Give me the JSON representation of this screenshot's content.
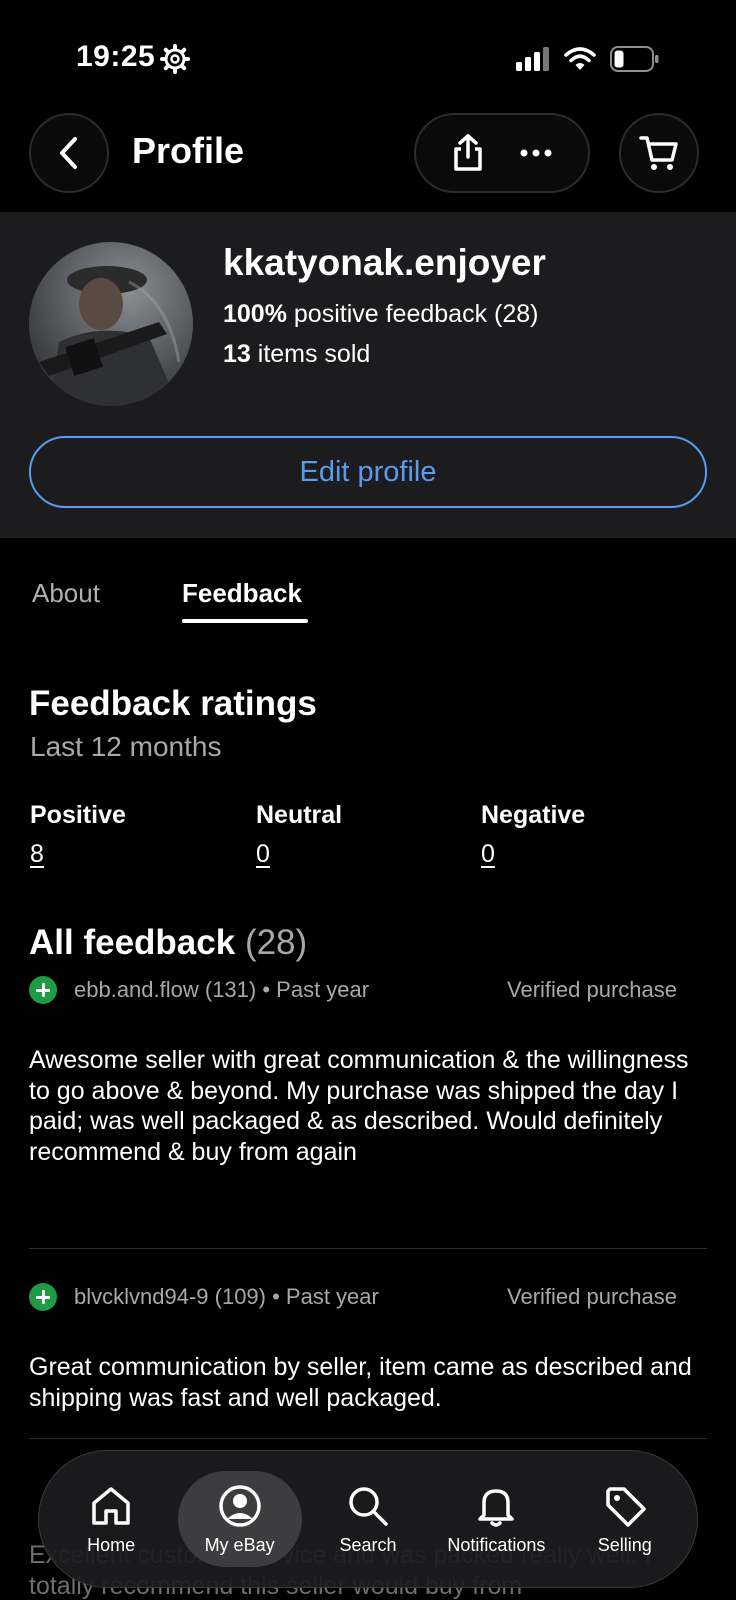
{
  "status_bar": {
    "time": "19:25"
  },
  "header": {
    "title": "Profile"
  },
  "profile": {
    "username": "kkatyonak.enjoyer",
    "feedback_percent": "100%",
    "feedback_text": " positive feedback (28)",
    "items_sold_count": "13",
    "items_sold_text": " items sold",
    "edit_button": "Edit profile"
  },
  "tabs": [
    {
      "label": "About",
      "active": false
    },
    {
      "label": "Feedback",
      "active": true
    }
  ],
  "ratings": {
    "title": "Feedback ratings",
    "subtitle": "Last 12 months",
    "positive": {
      "label": "Positive",
      "value": "8"
    },
    "neutral": {
      "label": "Neutral",
      "value": "0"
    },
    "negative": {
      "label": "Negative",
      "value": "0"
    }
  },
  "all_feedback": {
    "title": "All feedback",
    "count": "(28)",
    "items": [
      {
        "user": "ebb.and.flow (131) • Past year",
        "verified": "Verified purchase",
        "text": "Awesome seller with great communication & the willingness to go above & beyond. My purchase was shipped the day I paid; was well packaged & as described. Would definitely recommend & buy from again"
      },
      {
        "user": "blvcklvnd94-9 (109) • Past year",
        "verified": "Verified purchase",
        "text": "Great communication by seller, item came as described and shipping was fast and well packaged."
      }
    ],
    "partial_text": "Excellent customer service and was packed really well. I totally recommend this seller would buy from"
  },
  "bottom_nav": [
    {
      "label": "Home",
      "icon": "home-icon",
      "active": false
    },
    {
      "label": "My eBay",
      "icon": "user-circle-icon",
      "active": true
    },
    {
      "label": "Search",
      "icon": "search-icon",
      "active": false
    },
    {
      "label": "Notifications",
      "icon": "bell-icon",
      "active": false
    },
    {
      "label": "Selling",
      "icon": "tag-icon",
      "active": false
    }
  ],
  "colors": {
    "accent": "#5a9bf0",
    "positive": "#1f9b45",
    "card": "#1c1c1e"
  }
}
